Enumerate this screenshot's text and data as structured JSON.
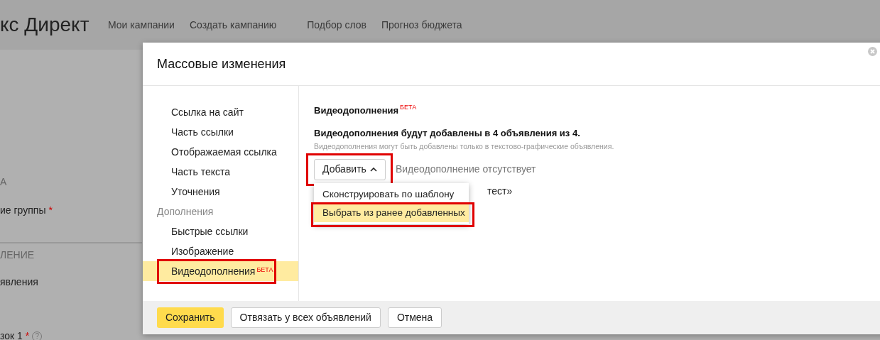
{
  "header": {
    "logo": "кс Директ",
    "nav": [
      "Мои кампании",
      "Создать кампанию",
      "Подбор слов",
      "Прогноз бюджета"
    ]
  },
  "background_form": {
    "labels": [
      {
        "text": "А",
        "kind": "section",
        "required": false,
        "help": false
      },
      {
        "text": "ие группы",
        "kind": "field",
        "required": true,
        "help": false
      },
      {
        "text": "ЛЕНИЕ",
        "kind": "section",
        "required": false,
        "help": false
      },
      {
        "text": "явления",
        "kind": "field",
        "required": false,
        "help": false
      },
      {
        "text": "зок 1",
        "kind": "field",
        "required": true,
        "help": true
      }
    ],
    "required_mark": "*",
    "help_mark": "?"
  },
  "dialog": {
    "title": "Массовые изменения",
    "nav": [
      {
        "label": "Ссылка на сайт",
        "kind": "item",
        "selected": false,
        "highlighted": false
      },
      {
        "label": "Часть ссылки",
        "kind": "item",
        "selected": false,
        "highlighted": false
      },
      {
        "label": "Отображаемая ссылка",
        "kind": "item",
        "selected": false,
        "highlighted": false
      },
      {
        "label": "Часть текста",
        "kind": "item",
        "selected": false,
        "highlighted": false
      },
      {
        "label": "Уточнения",
        "kind": "item",
        "selected": false,
        "highlighted": false
      },
      {
        "label": "Дополнения",
        "kind": "group"
      },
      {
        "label": "Быстрые ссылки",
        "kind": "item",
        "selected": false,
        "highlighted": false
      },
      {
        "label": "Изображение",
        "kind": "item",
        "selected": false,
        "highlighted": false
      },
      {
        "label": "Видеодополнения",
        "kind": "item",
        "badge": "БЕТА",
        "selected": true,
        "highlighted": true
      }
    ],
    "section": {
      "title": "Видеодополнения",
      "badge": "БЕТА",
      "summary": "Видеодополнения будут добавлены в 4 объявления из 4.",
      "hint": "Видеодополнения могут быть добавлены только в текстово-графические объявления.",
      "add_button": {
        "label": "Добавить",
        "expanded": true,
        "highlighted": true
      },
      "status": "Видеодополнение отсутствует",
      "behind_text": "тест»",
      "menu": [
        {
          "label": "Сконструировать по шаблону",
          "selected": false,
          "highlighted": false
        },
        {
          "label": "Выбрать из ранее добавленных",
          "selected": true,
          "highlighted": true
        }
      ]
    },
    "buttons": [
      {
        "label": "Сохранить",
        "kind": "primary"
      },
      {
        "label": "Отвязать у всех объявлений",
        "kind": "default"
      },
      {
        "label": "Отмена",
        "kind": "default"
      }
    ]
  }
}
